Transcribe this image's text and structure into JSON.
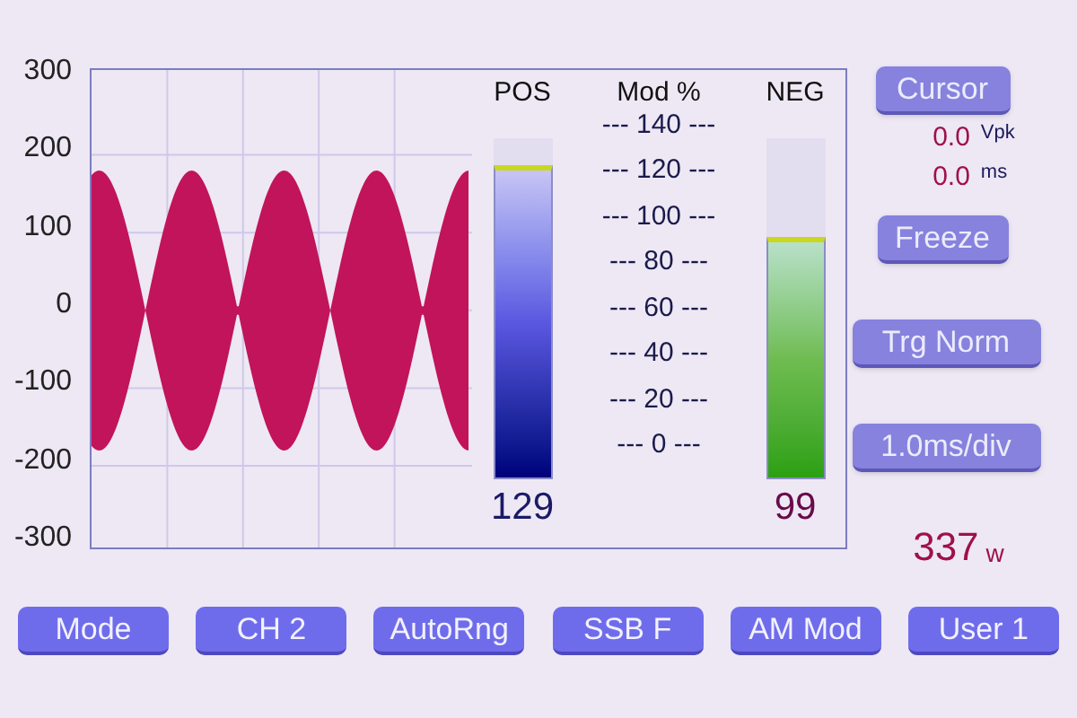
{
  "plot": {
    "y_axis_labels": [
      "300",
      "200",
      "100",
      "0",
      "-100",
      "-200",
      "-300"
    ]
  },
  "meters": {
    "title": "Mod %",
    "scale": [
      "--- 140 ---",
      "--- 120 ---",
      "--- 100 ---",
      "--- 80 ---",
      "--- 60 ---",
      "--- 40 ---",
      "--- 20 ---",
      "--- 0 ---"
    ],
    "channels": [
      {
        "kind": "positive",
        "label": "POS",
        "level": 0.92,
        "reading": "129"
      },
      {
        "kind": "negative",
        "label": "NEG",
        "level": 0.71,
        "reading": "99"
      }
    ]
  },
  "side_panel": {
    "cursor_button": "Cursor",
    "cursor_readouts": [
      {
        "value": "0.0",
        "unit": "Vpk"
      },
      {
        "value": "0.0",
        "unit": "ms"
      }
    ],
    "buttons": [
      "Freeze",
      "Trg Norm",
      "1.0ms/div"
    ],
    "power": {
      "value": "337",
      "unit": "w"
    }
  },
  "bottom_buttons": [
    "Mode",
    "CH 2",
    "AutoRng",
    "SSB F",
    "AM Mod",
    "User 1"
  ]
}
